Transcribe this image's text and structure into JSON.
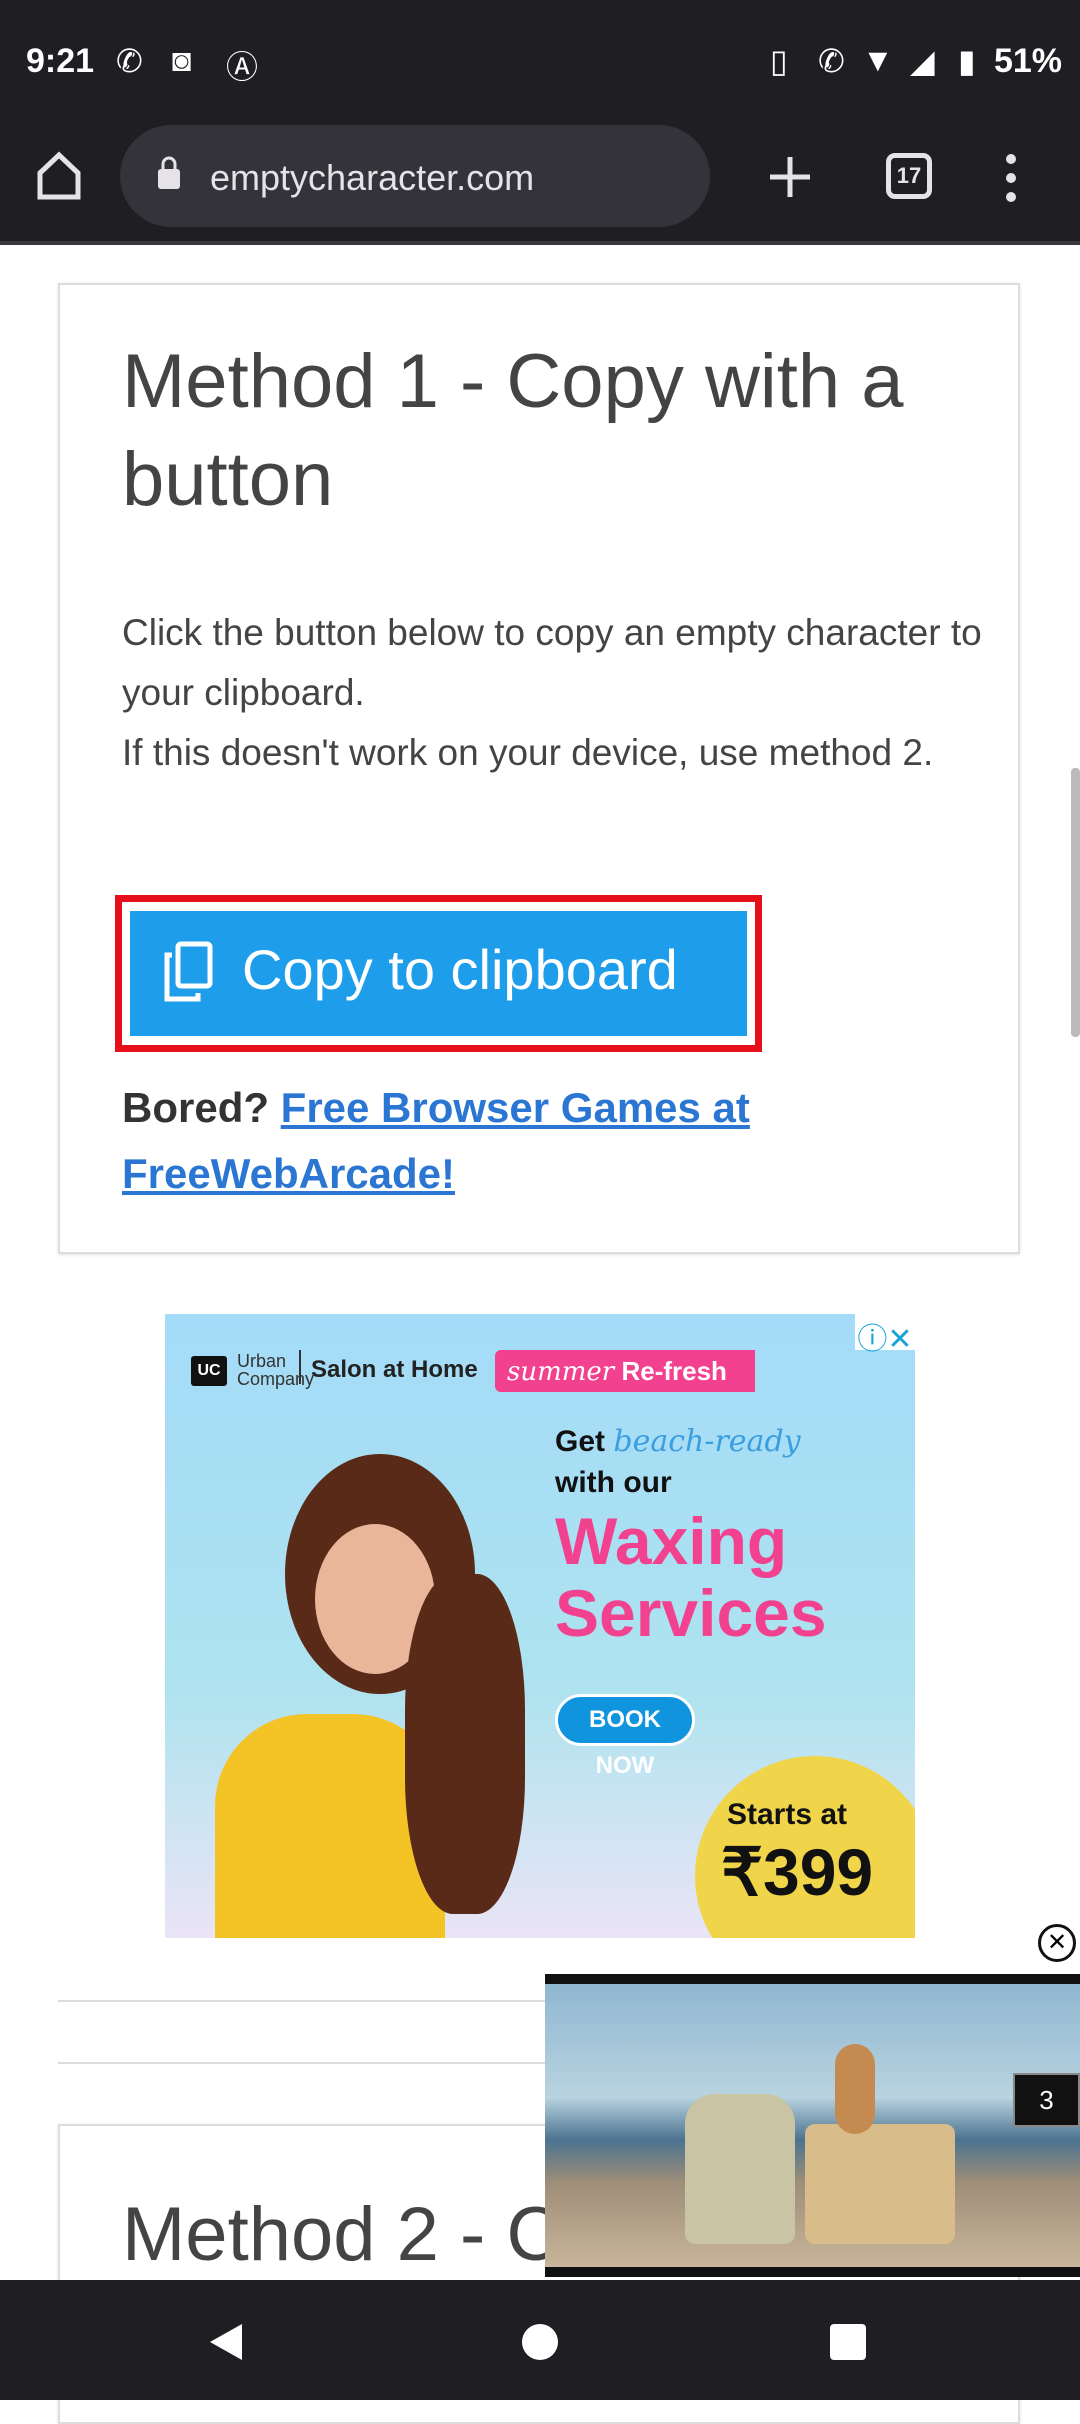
{
  "status_bar": {
    "time": "9:21",
    "battery": "51%",
    "notification_icons": [
      "whatsapp-icon",
      "instagram-icon",
      "app-a-icon"
    ],
    "system_icons": [
      "vibrate-icon",
      "wifi-calling-icon",
      "wifi-icon",
      "signal-icon",
      "battery-icon"
    ]
  },
  "browser": {
    "url": "emptycharacter.com",
    "tab_count": "17"
  },
  "method1": {
    "title": "Method 1 - Copy with a button",
    "text1": "Click the button below to copy an empty character to your clipboard.",
    "text2": "If this doesn't work on your device, use method 2.",
    "button_label": "Copy to clipboard",
    "bored_label": "Bored?",
    "bored_link": "Free Browser Games at FreeWebArcade!"
  },
  "ad": {
    "brand_line1": "Urban",
    "brand_line2": "Company",
    "brand_logo": "UC",
    "tagline": "Salon at Home",
    "badge_script": "summer",
    "badge": "Re-fresh",
    "headline1": "Get",
    "headline_script": "beach-ready",
    "headline2": "with our",
    "headline3": "Waxing",
    "headline4": "Services",
    "cta": "BOOK NOW",
    "price_label": "Starts at",
    "price": "₹399"
  },
  "method2": {
    "title": "Method 2 - C"
  },
  "video": {
    "counter": "3"
  },
  "colors": {
    "accent": "#1e9eea",
    "highlight": "#e5101c",
    "link": "#2a76d2",
    "ad_pink": "#f2418f"
  }
}
